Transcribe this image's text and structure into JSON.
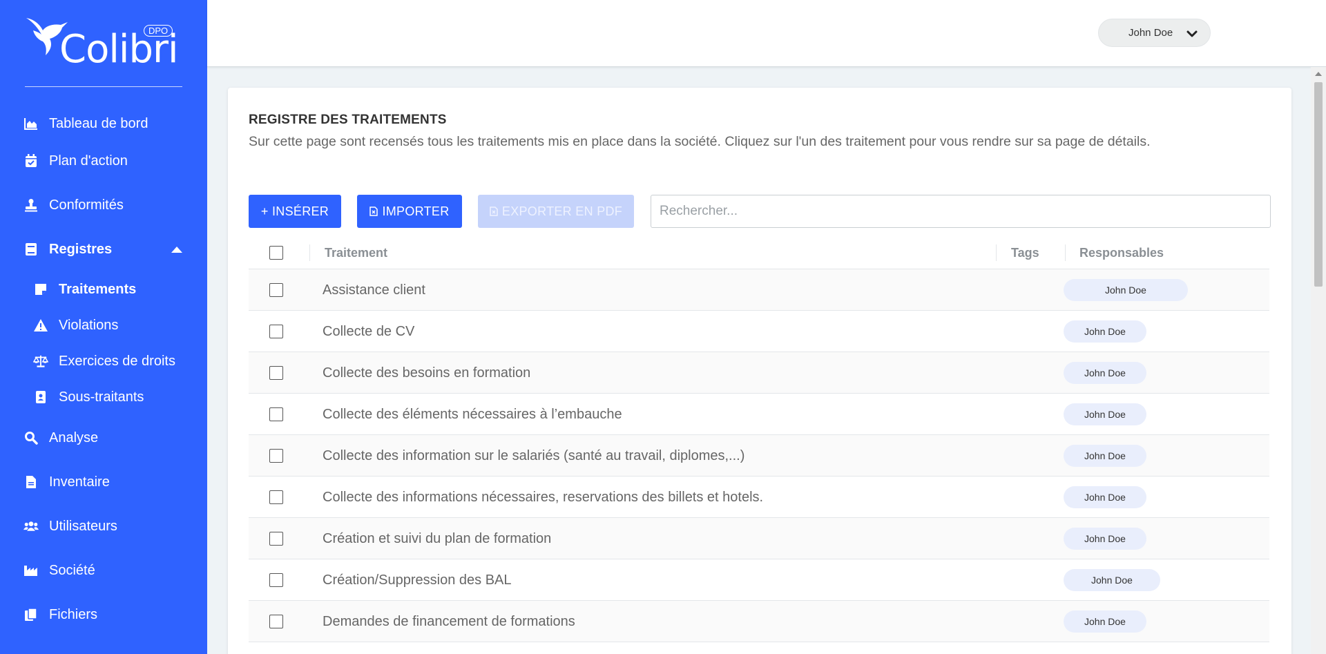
{
  "brand": {
    "name": "Colibri",
    "badge": "DPO"
  },
  "colors": {
    "primary": "#2f62ff",
    "disabled": "#c5d3fb",
    "pill": "#e9eefc"
  },
  "sidebar": {
    "items": [
      {
        "label": "Tableau de bord",
        "icon": "chart-area-icon"
      },
      {
        "label": "Plan d'action",
        "icon": "calendar-check-icon"
      },
      {
        "label": "Conformités",
        "icon": "stamp-icon"
      },
      {
        "label": "Registres",
        "icon": "book-icon",
        "expanded": true
      },
      {
        "label": "Traitements",
        "icon": "sticky-note-icon",
        "active": true
      },
      {
        "label": "Violations",
        "icon": "warning-icon"
      },
      {
        "label": "Exercices de droits",
        "icon": "balance-scale-icon"
      },
      {
        "label": "Sous-traitants",
        "icon": "id-badge-icon"
      },
      {
        "label": "Analyse",
        "icon": "search-icon"
      },
      {
        "label": "Inventaire",
        "icon": "file-icon"
      },
      {
        "label": "Utilisateurs",
        "icon": "users-icon"
      },
      {
        "label": "Société",
        "icon": "industry-icon"
      },
      {
        "label": "Fichiers",
        "icon": "copy-icon"
      }
    ]
  },
  "header": {
    "user_name": "John Doe"
  },
  "page": {
    "title": "REGISTRE DES TRAITEMENTS",
    "description": "Sur cette page sont recensés tous les traitements mis en place dans la société. Cliquez sur l'un des traitement pour vous rendre sur sa page de détails."
  },
  "toolbar": {
    "insert_label": "+ INSÉRER",
    "import_label": "IMPORTER",
    "export_label": "EXPORTER EN PDF",
    "search_placeholder": "Rechercher..."
  },
  "table": {
    "columns": [
      "Traitement",
      "Tags",
      "Responsables"
    ],
    "rows": [
      {
        "name": "Assistance client",
        "responsable": "John Doe"
      },
      {
        "name": "Collecte de CV",
        "responsable": "John Doe"
      },
      {
        "name": "Collecte des besoins en formation",
        "responsable": "John Doe"
      },
      {
        "name": "Collecte des éléments nécessaires à l’embauche",
        "responsable": "John Doe"
      },
      {
        "name": "Collecte des information sur le salariés (santé au travail, diplomes,...)",
        "responsable": "John Doe"
      },
      {
        "name": "Collecte des informations nécessaires, reservations des billets et hotels.",
        "responsable": "John Doe"
      },
      {
        "name": "Création et suivi du plan de formation",
        "responsable": "John Doe"
      },
      {
        "name": "Création/Suppression des BAL",
        "responsable": "John Doe"
      },
      {
        "name": "Demandes de financement de formations",
        "responsable": "John Doe"
      }
    ]
  }
}
